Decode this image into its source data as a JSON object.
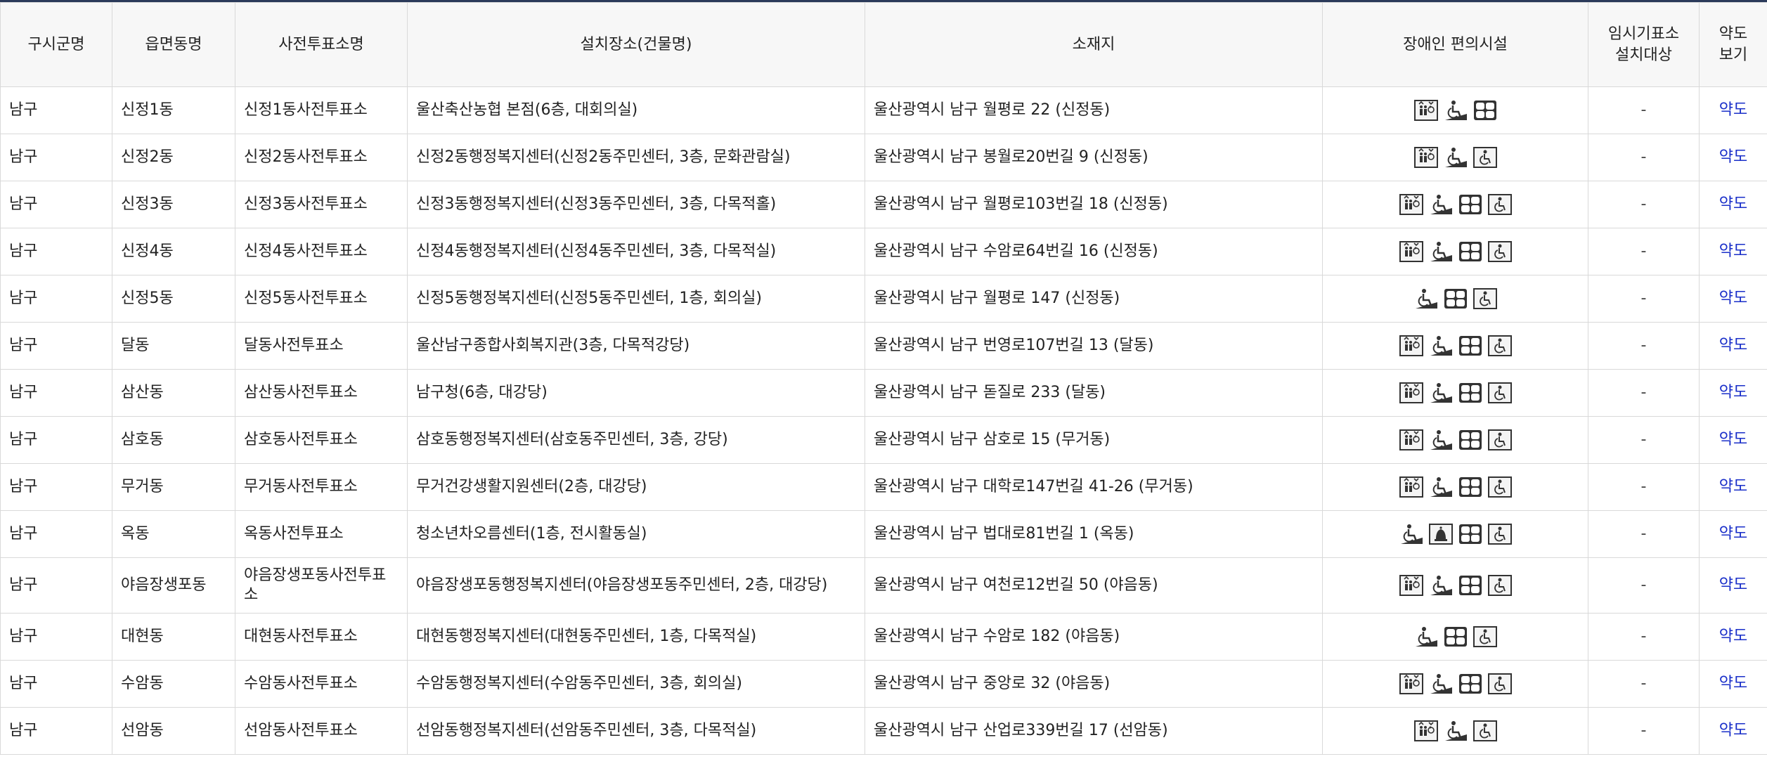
{
  "headers": {
    "col1": "구시군명",
    "col2": "읍면동명",
    "col3": "사전투표소명",
    "col4": "설치장소(건물명)",
    "col5": "소재지",
    "col6": "장애인 편의시설",
    "col7_line1": "임시기표소",
    "col7_line2": "설치대상",
    "col8_line1": "약도",
    "col8_line2": "보기"
  },
  "icon_legend": {
    "elevator": "elevator-icon",
    "ramp": "ramp-icon",
    "toilet": "accessible-toilet-icon",
    "parking": "accessible-parking-icon",
    "bell": "call-bell-icon"
  },
  "rows": [
    {
      "gu": "남구",
      "dong": "신정1동",
      "station": "신정1동사전투표소",
      "place": "울산축산농협 본점(6층, 대회의실)",
      "addr": "울산광역시 남구 월평로 22 (신정동)",
      "icons": [
        "elevator",
        "ramp",
        "toilet"
      ],
      "temp": "-",
      "map": "약도"
    },
    {
      "gu": "남구",
      "dong": "신정2동",
      "station": "신정2동사전투표소",
      "place": "신정2동행정복지센터(신정2동주민센터, 3층, 문화관람실)",
      "addr": "울산광역시 남구 봉월로20번길 9 (신정동)",
      "icons": [
        "elevator",
        "ramp",
        "parking"
      ],
      "temp": "-",
      "map": "약도"
    },
    {
      "gu": "남구",
      "dong": "신정3동",
      "station": "신정3동사전투표소",
      "place": "신정3동행정복지센터(신정3동주민센터, 3층, 다목적홀)",
      "addr": "울산광역시 남구 월평로103번길 18 (신정동)",
      "icons": [
        "elevator",
        "ramp",
        "toilet",
        "parking"
      ],
      "temp": "-",
      "map": "약도"
    },
    {
      "gu": "남구",
      "dong": "신정4동",
      "station": "신정4동사전투표소",
      "place": "신정4동행정복지센터(신정4동주민센터, 3층, 다목적실)",
      "addr": "울산광역시 남구 수암로64번길 16 (신정동)",
      "icons": [
        "elevator",
        "ramp",
        "toilet",
        "parking"
      ],
      "temp": "-",
      "map": "약도"
    },
    {
      "gu": "남구",
      "dong": "신정5동",
      "station": "신정5동사전투표소",
      "place": "신정5동행정복지센터(신정5동주민센터, 1층, 회의실)",
      "addr": "울산광역시 남구 월평로 147 (신정동)",
      "icons": [
        "ramp",
        "toilet",
        "parking"
      ],
      "temp": "-",
      "map": "약도"
    },
    {
      "gu": "남구",
      "dong": "달동",
      "station": "달동사전투표소",
      "place": "울산남구종합사회복지관(3층, 다목적강당)",
      "addr": "울산광역시 남구 번영로107번길 13 (달동)",
      "icons": [
        "elevator",
        "ramp",
        "toilet",
        "parking"
      ],
      "temp": "-",
      "map": "약도"
    },
    {
      "gu": "남구",
      "dong": "삼산동",
      "station": "삼산동사전투표소",
      "place": "남구청(6층, 대강당)",
      "addr": "울산광역시 남구 돋질로 233 (달동)",
      "icons": [
        "elevator",
        "ramp",
        "toilet",
        "parking"
      ],
      "temp": "-",
      "map": "약도"
    },
    {
      "gu": "남구",
      "dong": "삼호동",
      "station": "삼호동사전투표소",
      "place": "삼호동행정복지센터(삼호동주민센터, 3층, 강당)",
      "addr": "울산광역시 남구 삼호로 15 (무거동)",
      "icons": [
        "elevator",
        "ramp",
        "toilet",
        "parking"
      ],
      "temp": "-",
      "map": "약도"
    },
    {
      "gu": "남구",
      "dong": "무거동",
      "station": "무거동사전투표소",
      "place": "무거건강생활지원센터(2층, 대강당)",
      "addr": "울산광역시 남구 대학로147번길 41-26 (무거동)",
      "icons": [
        "elevator",
        "ramp",
        "toilet",
        "parking"
      ],
      "temp": "-",
      "map": "약도"
    },
    {
      "gu": "남구",
      "dong": "옥동",
      "station": "옥동사전투표소",
      "place": "청소년차오름센터(1층, 전시활동실)",
      "addr": "울산광역시 남구 법대로81번길 1 (옥동)",
      "icons": [
        "ramp",
        "bell",
        "toilet",
        "parking"
      ],
      "temp": "-",
      "map": "약도"
    },
    {
      "gu": "남구",
      "dong": "야음장생포동",
      "station": "야음장생포동사전투표소",
      "place": "야음장생포동행정복지센터(야음장생포동주민센터, 2층, 대강당)",
      "addr": "울산광역시 남구 여천로12번길 50 (야음동)",
      "icons": [
        "elevator",
        "ramp",
        "toilet",
        "parking"
      ],
      "temp": "-",
      "map": "약도"
    },
    {
      "gu": "남구",
      "dong": "대현동",
      "station": "대현동사전투표소",
      "place": "대현동행정복지센터(대현동주민센터, 1층, 다목적실)",
      "addr": "울산광역시 남구 수암로 182 (야음동)",
      "icons": [
        "ramp",
        "toilet",
        "parking"
      ],
      "temp": "-",
      "map": "약도"
    },
    {
      "gu": "남구",
      "dong": "수암동",
      "station": "수암동사전투표소",
      "place": "수암동행정복지센터(수암동주민센터, 3층, 회의실)",
      "addr": "울산광역시 남구 중앙로 32 (야음동)",
      "icons": [
        "elevator",
        "ramp",
        "toilet",
        "parking"
      ],
      "temp": "-",
      "map": "약도"
    },
    {
      "gu": "남구",
      "dong": "선암동",
      "station": "선암동사전투표소",
      "place": "선암동행정복지센터(선암동주민센터, 3층, 다목적실)",
      "addr": "울산광역시 남구 산업로339번길 17 (선암동)",
      "icons": [
        "elevator",
        "ramp",
        "parking"
      ],
      "temp": "-",
      "map": "약도"
    }
  ]
}
